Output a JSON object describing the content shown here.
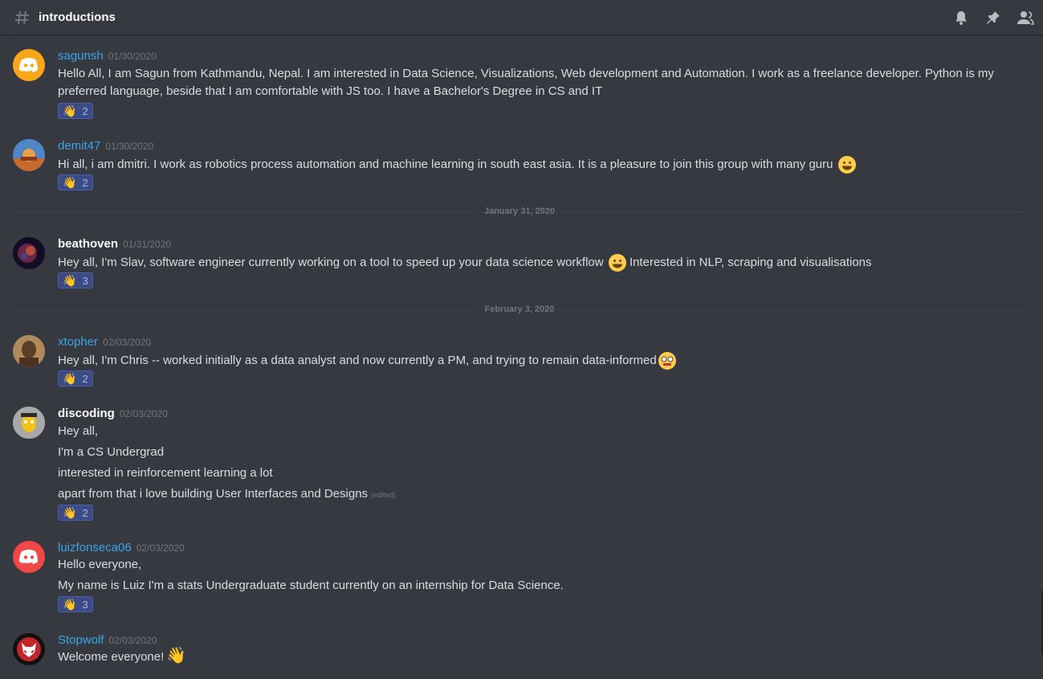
{
  "channel": {
    "name": "introductions"
  },
  "icons": {
    "hash": "hash-icon",
    "notifications": "bell-icon",
    "pins": "pin-icon",
    "members": "members-icon"
  },
  "colors": {
    "background": "#36393f",
    "link_name": "#3ba4e8",
    "reaction_bg": "#3b4b83"
  },
  "messages": [
    {
      "author": "sagunsh",
      "timestamp": "01/30/2020",
      "lines": [
        "Hello All, I am Sagun from Kathmandu, Nepal. I am interested in Data Science, Visualizations, Web development and Automation. I work as a freelance developer. Python is my",
        "preferred language, beside that I am comfortable with JS too. I have a Bachelor's Degree in CS and IT"
      ],
      "reaction": {
        "emoji": "👋",
        "count": "2"
      }
    },
    {
      "author": "demit47",
      "timestamp": "01/30/2020",
      "lines": [
        "Hi all, i am dmitri. I work as robotics process automation and machine learning in south east asia. It is a pleasure to join this group with many guru"
      ],
      "reaction": {
        "emoji": "👋",
        "count": "2"
      }
    },
    {
      "author": "beathoven",
      "timestamp": "01/31/2020",
      "lines": [
        "Hey all, I'm Slav, software engineer currently working on a tool to speed up your data science workflow",
        "Interested in NLP, scraping and visualisations"
      ],
      "reaction": {
        "emoji": "👋",
        "count": "3"
      }
    },
    {
      "author": "xtopher",
      "timestamp": "02/03/2020",
      "lines": [
        "Hey all, I'm Chris -- worked initially as a data analyst and now currently a PM, and trying to remain data-informed"
      ],
      "reaction": {
        "emoji": "👋",
        "count": "2"
      }
    },
    {
      "author": "discoding",
      "timestamp": "02/03/2020",
      "lines": [
        "Hey all,",
        "I'm a CS Undergrad",
        "interested in reinforcement learning a lot",
        "apart from that i love building User Interfaces and Designs"
      ],
      "edited": "(edited)",
      "reaction": {
        "emoji": "👋",
        "count": "2"
      }
    },
    {
      "author": "luizfonseca06",
      "timestamp": "02/03/2020",
      "lines": [
        "Hello everyone,",
        "My name is Luiz I'm a stats Undergraduate student currently on an internship for Data Science."
      ],
      "reaction": {
        "emoji": "👋",
        "count": "3"
      }
    },
    {
      "author": "Stopwolf",
      "timestamp": "02/03/2020",
      "lines": [
        "Welcome everyone!"
      ],
      "emoji": "👋"
    }
  ],
  "dividers": [
    "January 31, 2020",
    "February 3, 2020"
  ]
}
